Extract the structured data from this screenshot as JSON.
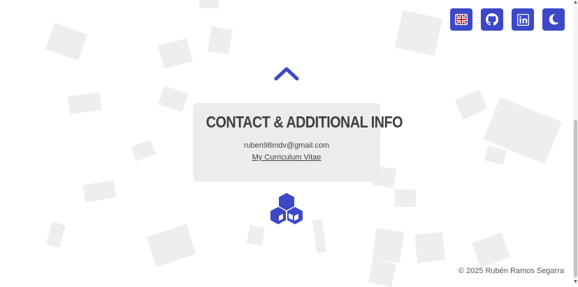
{
  "topbar": {
    "language": {
      "icon": "uk-flag-icon"
    },
    "github": {
      "icon": "github-icon"
    },
    "linkedin": {
      "icon": "linkedin-icon"
    },
    "theme": {
      "icon": "moon-icon"
    }
  },
  "colors": {
    "accent": "#3c48c8",
    "card_bg": "#ececec",
    "title": "#3f3f3f"
  },
  "nav": {
    "scroll_up_icon": "chevron-up-icon"
  },
  "contact": {
    "title": "CONTACT & ADDITIONAL INFO",
    "email": "ruben98mdv@gmail.com",
    "cv_link": "My Curriculum Vitae"
  },
  "logo": {
    "icon": "cubes-logo-icon"
  },
  "footer": {
    "copyright": "© 2025 Rubén Ramos Segarra"
  }
}
